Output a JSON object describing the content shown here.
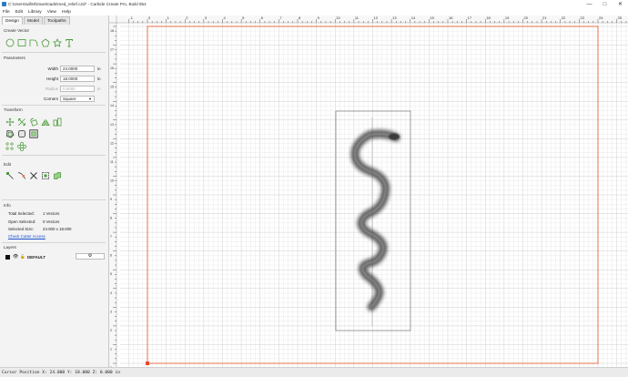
{
  "window": {
    "title": "C:\\Users\\willst\\Downloads\\med_relief.c2d* - Carbide Create Pro, Build 854",
    "minimize": "—",
    "maximize": "□",
    "close": "✕"
  },
  "menu": [
    "File",
    "Edit",
    "Library",
    "View",
    "Help"
  ],
  "tabs": [
    "Design",
    "Model",
    "Toolpaths"
  ],
  "create_vector": {
    "title": "Create Vector",
    "icons": [
      "circle-icon",
      "rectangle-icon",
      "curve-icon",
      "polygon-icon",
      "star-icon",
      "text-icon"
    ]
  },
  "parameters": {
    "title": "Parameters",
    "width_label": "Width",
    "width_value": "24.0000",
    "width_unit": "in",
    "height_label": "Height",
    "height_value": "18.0000",
    "height_unit": "in",
    "radius_label": "Radius",
    "radius_value": "0.0000",
    "radius_unit": "in",
    "corners_label": "Corners",
    "corners_value": "Square"
  },
  "transform": {
    "title": "Transform"
  },
  "edit": {
    "title": "Edit"
  },
  "info": {
    "title": "Info",
    "total_selected_label": "Total Selected:",
    "total_selected_value": "1 Vectors",
    "open_selected_label": "Open Selected:",
    "open_selected_value": "0 Vectors",
    "selected_size_label": "Selected Size:",
    "selected_size_value": "24.000 x 18.000",
    "check_cutter_access": "Check Cutter Access"
  },
  "layers": {
    "title": "Layers",
    "items": [
      {
        "name": "DEFAULT",
        "color": "#000000"
      }
    ],
    "add_button": "+"
  },
  "ruler": {
    "x_labels": [
      "-1",
      "0",
      "1",
      "2",
      "3",
      "4",
      "5",
      "6",
      "7",
      "8",
      "9",
      "10",
      "11",
      "12",
      "13",
      "14",
      "15",
      "16",
      "17",
      "18",
      "19",
      "20",
      "21",
      "22",
      "23",
      "24",
      "25"
    ],
    "y_labels": [
      "18",
      "17",
      "16",
      "15",
      "14",
      "13",
      "12",
      "11",
      "10",
      "9",
      "8",
      "7",
      "6",
      "5",
      "4",
      "3",
      "2",
      "1",
      "0"
    ]
  },
  "status": {
    "cursor_position": "Cursor Position X: 24.000 Y: 18.000 Z: 0.000 in"
  },
  "colors": {
    "stock_border": "#e8704a",
    "grid_minor": "#e9e9e9",
    "grid_major": "#cfcfcf",
    "link": "#1a4fd0",
    "icon_green": "#4a9a3a"
  }
}
